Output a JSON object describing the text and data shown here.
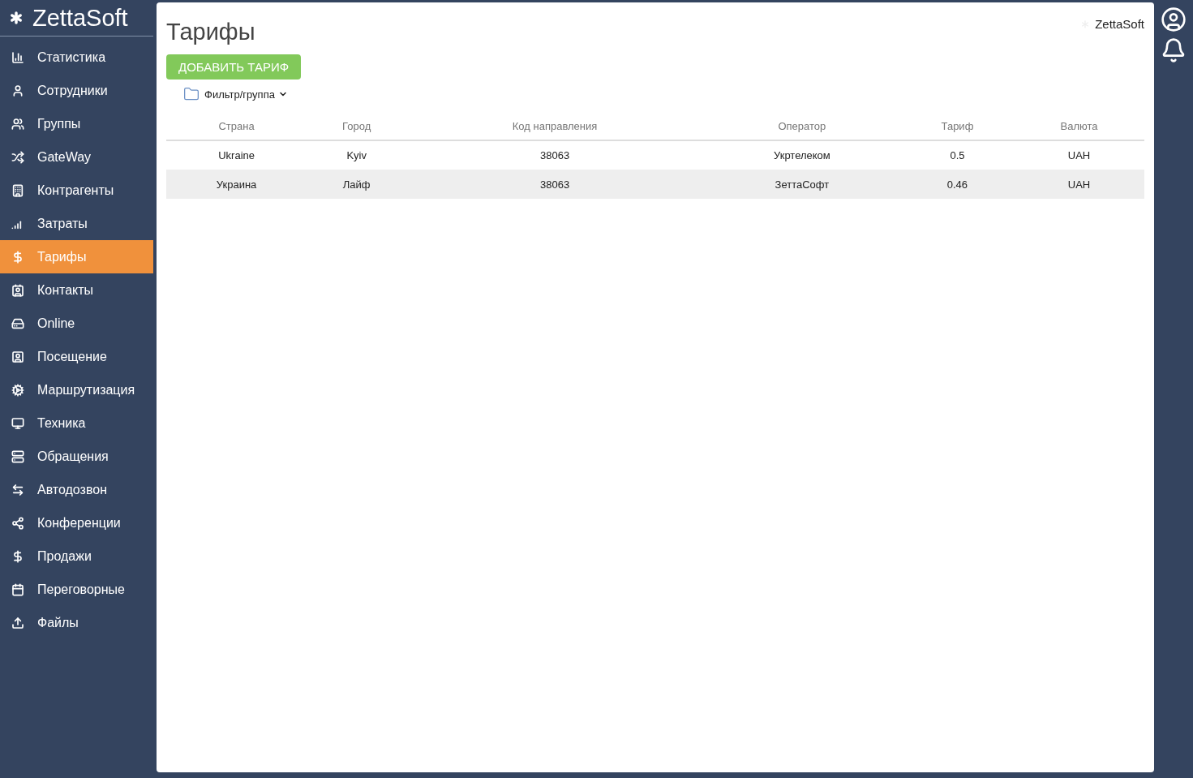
{
  "sidebar": {
    "logo": "ZettaSoft",
    "items": [
      {
        "label": "Статистика",
        "selected": false
      },
      {
        "label": "Сотрудники",
        "selected": false
      },
      {
        "label": "Группы",
        "selected": false
      },
      {
        "label": "GateWay",
        "selected": false
      },
      {
        "label": "Контрагенты",
        "selected": false
      },
      {
        "label": "Затраты",
        "selected": false
      },
      {
        "label": "Тарифы",
        "selected": true
      },
      {
        "label": "Контакты",
        "selected": false
      },
      {
        "label": "Online",
        "selected": false
      },
      {
        "label": "Посещение",
        "selected": false
      },
      {
        "label": "Маршрутизация",
        "selected": false
      },
      {
        "label": "Техника",
        "selected": false
      },
      {
        "label": "Обращения",
        "selected": false
      },
      {
        "label": "Автодозвон",
        "selected": false
      },
      {
        "label": "Конференции",
        "selected": false
      },
      {
        "label": "Продажи",
        "selected": false
      },
      {
        "label": "Переговорные",
        "selected": false
      },
      {
        "label": "Файлы",
        "selected": false
      }
    ]
  },
  "page": {
    "title": "Тарифы",
    "brand": "ZettaSoft",
    "add_button": "ДОБАВИТЬ ТАРИФ",
    "filter": "Фильтр/группа"
  },
  "table": {
    "columns": [
      "Страна",
      "Город",
      "Код направления",
      "Оператор",
      "Тариф",
      "Валюта"
    ],
    "rows": [
      [
        "Ukraine",
        "Kyiv",
        "38063",
        "Укртелеком",
        "0.5",
        "UAH"
      ],
      [
        "Украина",
        "Лайф",
        "38063",
        "ЗеттаСофт",
        "0.46",
        "UAH"
      ]
    ]
  }
}
